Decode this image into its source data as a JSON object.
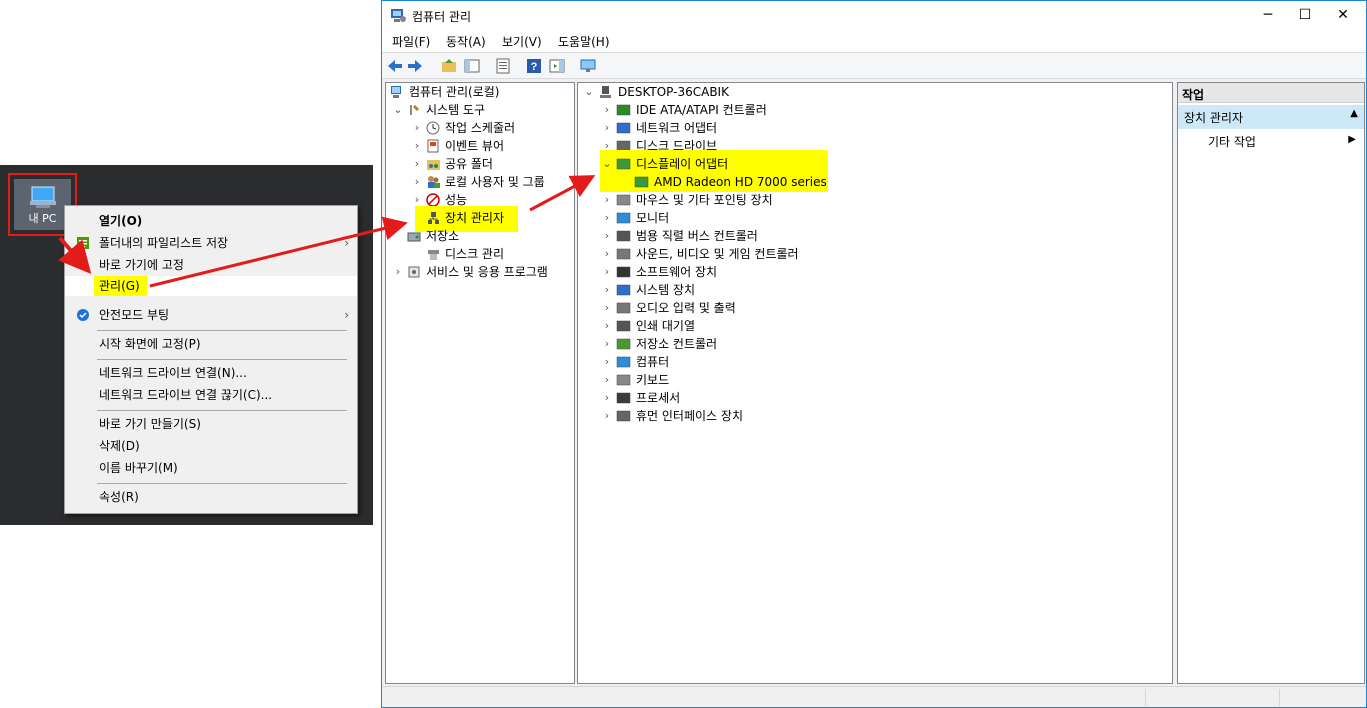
{
  "desktop": {
    "icon_label": "내 PC",
    "context_menu": {
      "items": [
        {
          "label": "열기(O)"
        },
        {
          "label": "폴더내의 파일리스트 저장"
        },
        {
          "label": "바로 가기에 고정"
        },
        {
          "label": "관리(G)"
        },
        {
          "label": "안전모드 부팅"
        },
        {
          "label": "시작 화면에 고정(P)"
        },
        {
          "label": "네트워크 드라이브 연결(N)..."
        },
        {
          "label": "네트워크 드라이브 연결 끊기(C)..."
        },
        {
          "label": "바로 가기 만들기(S)"
        },
        {
          "label": "삭제(D)"
        },
        {
          "label": "이름 바꾸기(M)"
        },
        {
          "label": "속성(R)"
        }
      ]
    }
  },
  "window": {
    "title": "컴퓨터 관리",
    "menu": [
      "파일(F)",
      "동작(A)",
      "보기(V)",
      "도움말(H)"
    ],
    "left_tree": {
      "root": "컴퓨터 관리(로컬)",
      "items": [
        {
          "label": "시스템 도구",
          "icon": "tools-icon"
        },
        {
          "label": "작업 스케줄러",
          "icon": "clock-icon"
        },
        {
          "label": "이벤트 뷰어",
          "icon": "event-viewer-icon"
        },
        {
          "label": "공유 폴더",
          "icon": "shared-folder-icon"
        },
        {
          "label": "로컬 사용자 및 그룹",
          "icon": "users-icon"
        },
        {
          "label": "성능",
          "icon": "performance-icon"
        },
        {
          "label": "장치 관리자",
          "icon": "device-manager-icon"
        },
        {
          "label": "저장소",
          "icon": "storage-icon"
        },
        {
          "label": "디스크 관리",
          "icon": "disk-icon"
        },
        {
          "label": "서비스 및 응용 프로그램",
          "icon": "services-icon"
        }
      ]
    },
    "device_tree": {
      "computer_name": "DESKTOP-36CABIK",
      "categories": [
        {
          "label": "IDE ATA/ATAPI 컨트롤러"
        },
        {
          "label": "네트워크 어댑터"
        },
        {
          "label": "디스크 드라이브"
        },
        {
          "label": "디스플레이 어댑터",
          "expanded": true
        },
        {
          "label": "AMD Radeon HD 7000 series",
          "child": true
        },
        {
          "label": "마우스 및 기타 포인팅 장치"
        },
        {
          "label": "모니터"
        },
        {
          "label": "범용 직렬 버스 컨트롤러"
        },
        {
          "label": "사운드, 비디오 및 게임 컨트롤러"
        },
        {
          "label": "소프트웨어 장치"
        },
        {
          "label": "시스템 장치"
        },
        {
          "label": "오디오 입력 및 출력"
        },
        {
          "label": "인쇄 대기열"
        },
        {
          "label": "저장소 컨트롤러"
        },
        {
          "label": "컴퓨터"
        },
        {
          "label": "키보드"
        },
        {
          "label": "프로세서"
        },
        {
          "label": "휴먼 인터페이스 장치"
        }
      ]
    },
    "actions": {
      "header": "작업",
      "section": "장치 관리자",
      "other": "기타 작업"
    }
  },
  "colors": {
    "highlight": "#ffff00",
    "annotation_red": "#e31b1b",
    "selected_section": "#cde8f6"
  }
}
